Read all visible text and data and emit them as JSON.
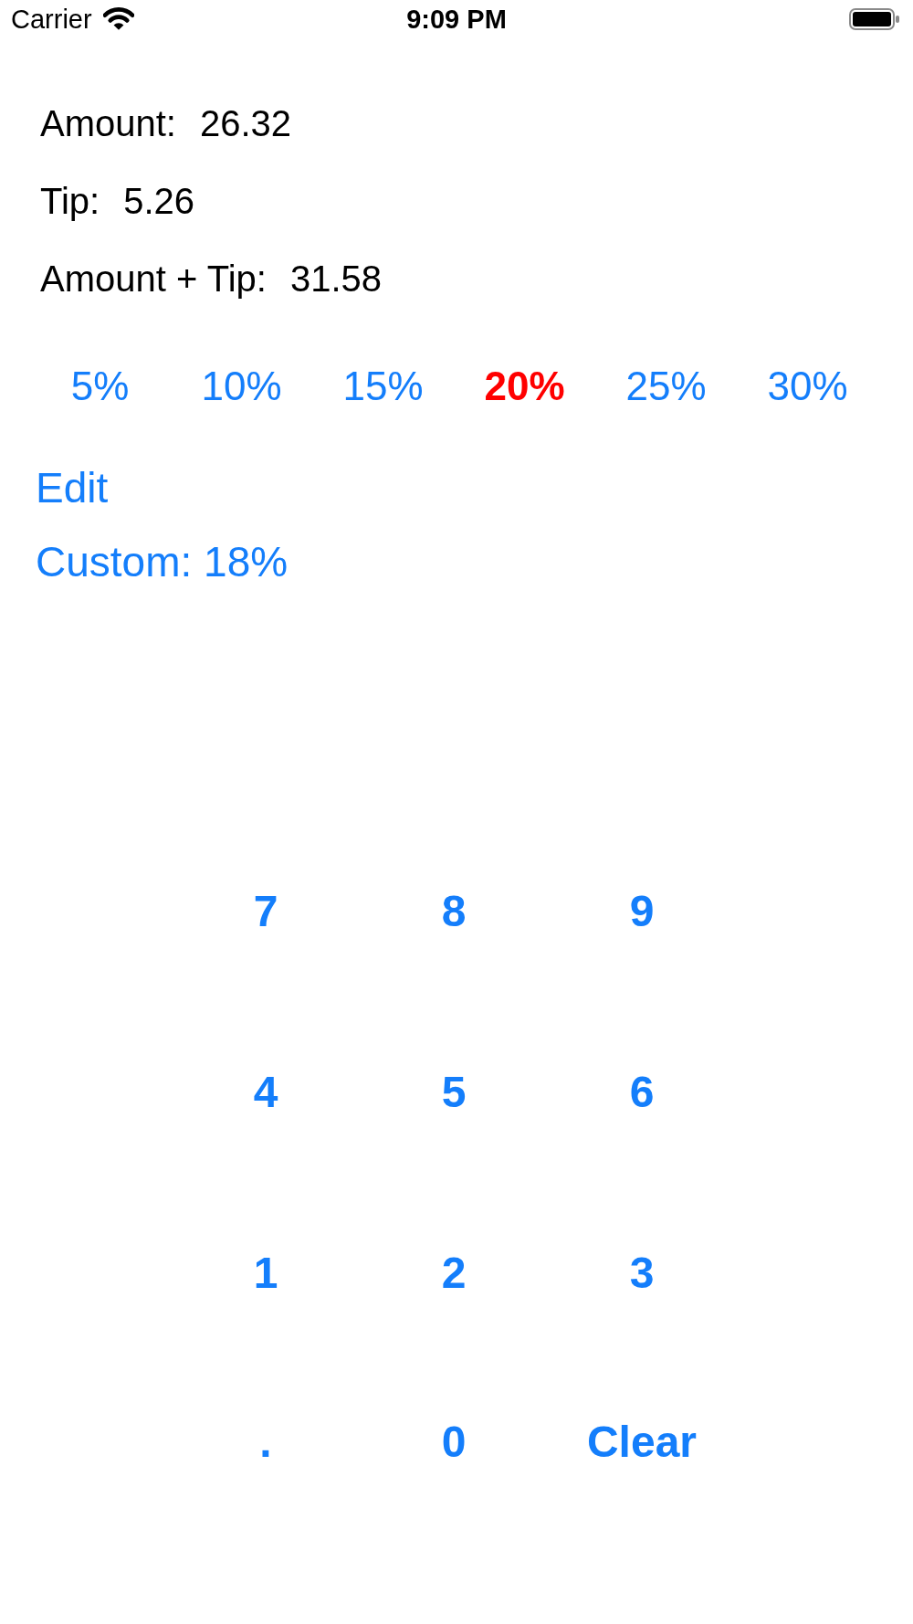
{
  "status_bar": {
    "carrier": "Carrier",
    "time": "9:09 PM"
  },
  "summary": [
    {
      "label": "Amount:",
      "value": "26.32"
    },
    {
      "label": "Tip:",
      "value": "5.26"
    },
    {
      "label": "Amount + Tip:",
      "value": "31.58"
    }
  ],
  "tip_options": [
    {
      "label": "5%",
      "selected": false
    },
    {
      "label": "10%",
      "selected": false
    },
    {
      "label": "15%",
      "selected": false
    },
    {
      "label": "20%",
      "selected": true
    },
    {
      "label": "25%",
      "selected": false
    },
    {
      "label": "30%",
      "selected": false
    }
  ],
  "edit_button": "Edit",
  "custom_button": "Custom: 18%",
  "keypad": [
    "7",
    "8",
    "9",
    "4",
    "5",
    "6",
    "1",
    "2",
    "3",
    ".",
    "0",
    "Clear"
  ]
}
